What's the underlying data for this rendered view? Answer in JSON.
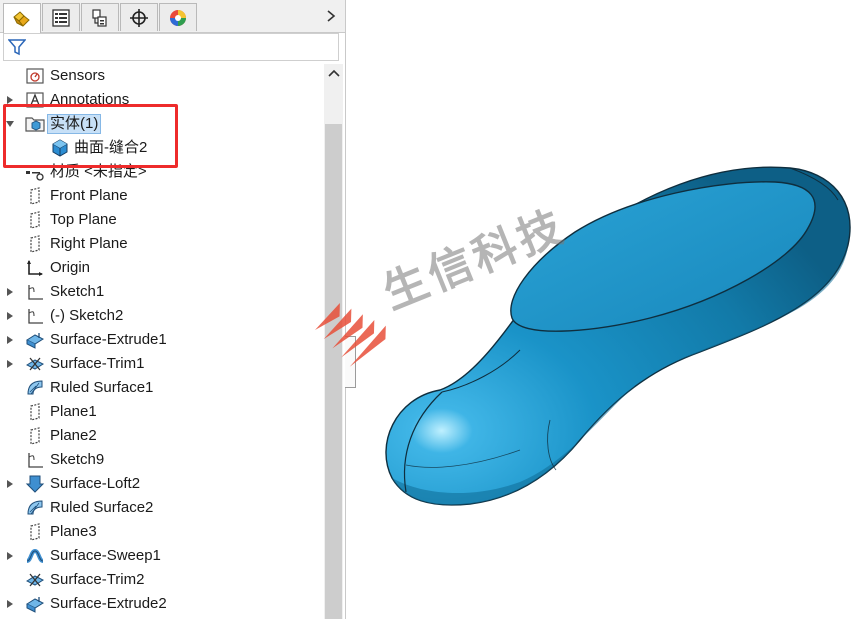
{
  "tabs": [
    {
      "id": "feature-manager",
      "icon": "feature-manager-icon",
      "active": true
    },
    {
      "id": "property-manager",
      "icon": "property-manager-icon",
      "active": false
    },
    {
      "id": "configuration-manager",
      "icon": "configuration-manager-icon",
      "active": false
    },
    {
      "id": "dimxpert-manager",
      "icon": "crosshair-icon",
      "active": false
    },
    {
      "id": "display-manager",
      "icon": "appearance-icon",
      "active": false
    }
  ],
  "tree": {
    "items": [
      {
        "label": "Sensors",
        "icon": "sensors-icon",
        "expandable": false
      },
      {
        "label": "Annotations",
        "icon": "annotations-icon",
        "expandable": true
      },
      {
        "label": "实体(1)",
        "icon": "solid-bodies-folder-icon",
        "expandable": true,
        "expanded": true,
        "selected": true
      },
      {
        "label": "曲面-缝合2",
        "icon": "solid-body-icon",
        "expandable": false,
        "child": true
      },
      {
        "label": "材质 <未指定>",
        "icon": "material-icon",
        "expandable": false
      },
      {
        "label": "Front Plane",
        "icon": "plane-icon",
        "expandable": false
      },
      {
        "label": "Top Plane",
        "icon": "plane-icon",
        "expandable": false
      },
      {
        "label": "Right Plane",
        "icon": "plane-icon",
        "expandable": false
      },
      {
        "label": "Origin",
        "icon": "origin-icon",
        "expandable": false
      },
      {
        "label": "Sketch1",
        "icon": "sketch-icon",
        "expandable": true
      },
      {
        "label": "(-) Sketch2",
        "icon": "sketch-icon",
        "expandable": true
      },
      {
        "label": "Surface-Extrude1",
        "icon": "surface-extrude-icon",
        "expandable": true
      },
      {
        "label": "Surface-Trim1",
        "icon": "surface-trim-icon",
        "expandable": true
      },
      {
        "label": "Ruled Surface1",
        "icon": "ruled-surface-icon",
        "expandable": false
      },
      {
        "label": "Plane1",
        "icon": "plane-icon",
        "expandable": false
      },
      {
        "label": "Plane2",
        "icon": "plane-icon",
        "expandable": false
      },
      {
        "label": "Sketch9",
        "icon": "sketch-icon",
        "expandable": false
      },
      {
        "label": "Surface-Loft2",
        "icon": "surface-loft-icon",
        "expandable": true
      },
      {
        "label": "Ruled Surface2",
        "icon": "ruled-surface-icon",
        "expandable": false
      },
      {
        "label": "Plane3",
        "icon": "plane-icon",
        "expandable": false
      },
      {
        "label": "Surface-Sweep1",
        "icon": "surface-sweep-icon",
        "expandable": true
      },
      {
        "label": "Surface-Trim2",
        "icon": "surface-trim-icon",
        "expandable": false
      },
      {
        "label": "Surface-Extrude2",
        "icon": "surface-extrude-icon",
        "expandable": true
      }
    ]
  },
  "watermark": {
    "text": "生信科技"
  },
  "colors": {
    "model_body": "#1a93c8",
    "model_top_face": "#1f8fc0",
    "model_edge": "#0f2e3e",
    "highlight_box": "#ee2b2b",
    "selection_bg": "#c7e0f7",
    "watermark_red": "#e8503a"
  }
}
